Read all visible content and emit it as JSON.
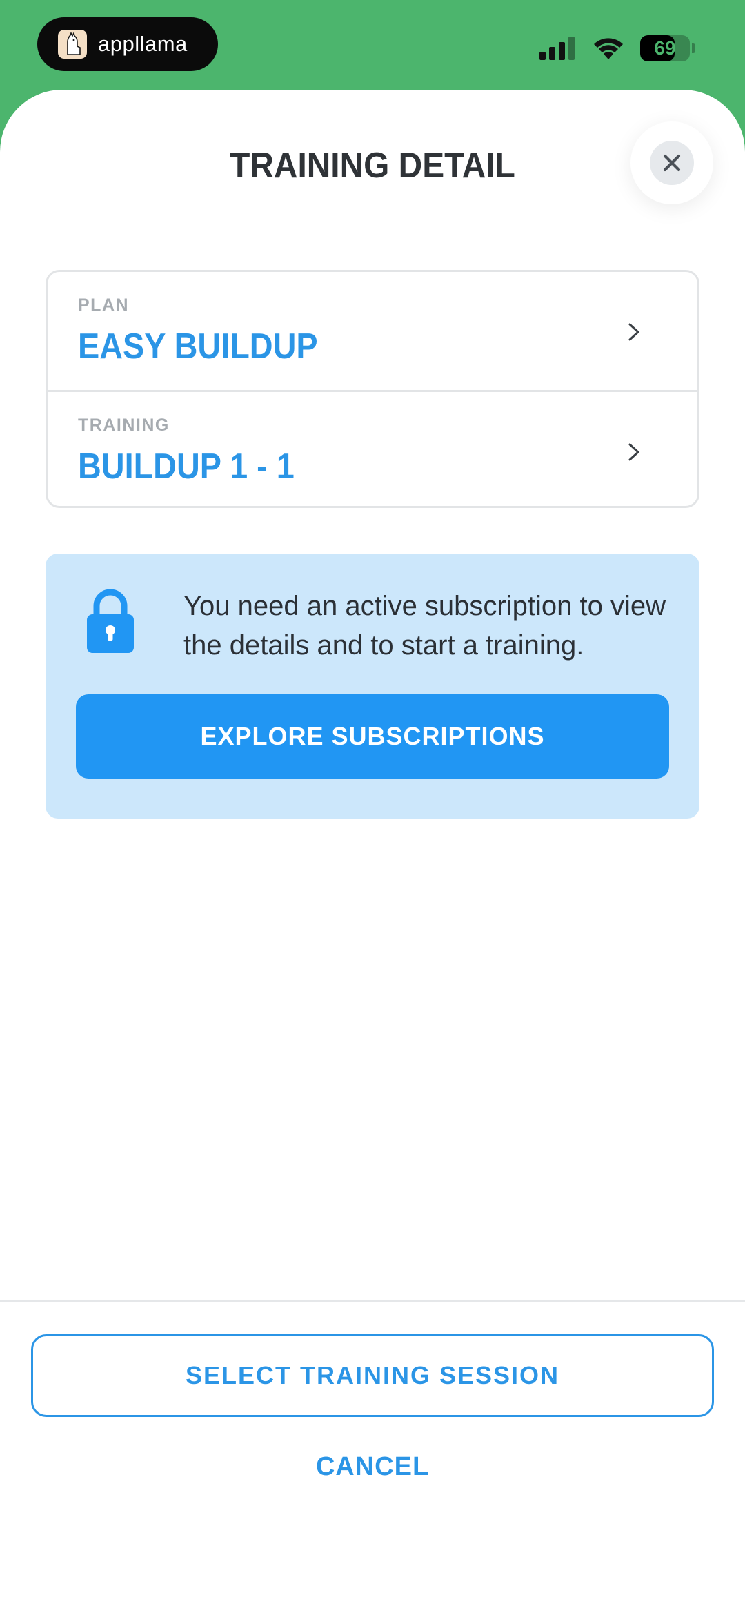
{
  "status_bar": {
    "app_name": "appllama",
    "battery": "69",
    "battery_level": 0.69
  },
  "sheet": {
    "title": "TRAINING DETAIL",
    "close_icon": "close-icon"
  },
  "detail_card": {
    "plan_label": "PLAN",
    "plan_value": "EASY BUILDUP",
    "training_label": "TRAINING",
    "training_value": "BUILDUP 1 - 1"
  },
  "notice": {
    "icon": "lock-icon",
    "message": "You need an active subscription to view the details and to start a training.",
    "button_label": "EXPLORE SUBSCRIPTIONS"
  },
  "footer": {
    "select_label": "SELECT TRAINING SESSION",
    "cancel_label": "CANCEL"
  },
  "colors": {
    "brand_green": "#4CB56D",
    "accent_blue": "#2196F3",
    "link_blue": "#2B95E6",
    "notice_bg": "#CCE7FB"
  }
}
